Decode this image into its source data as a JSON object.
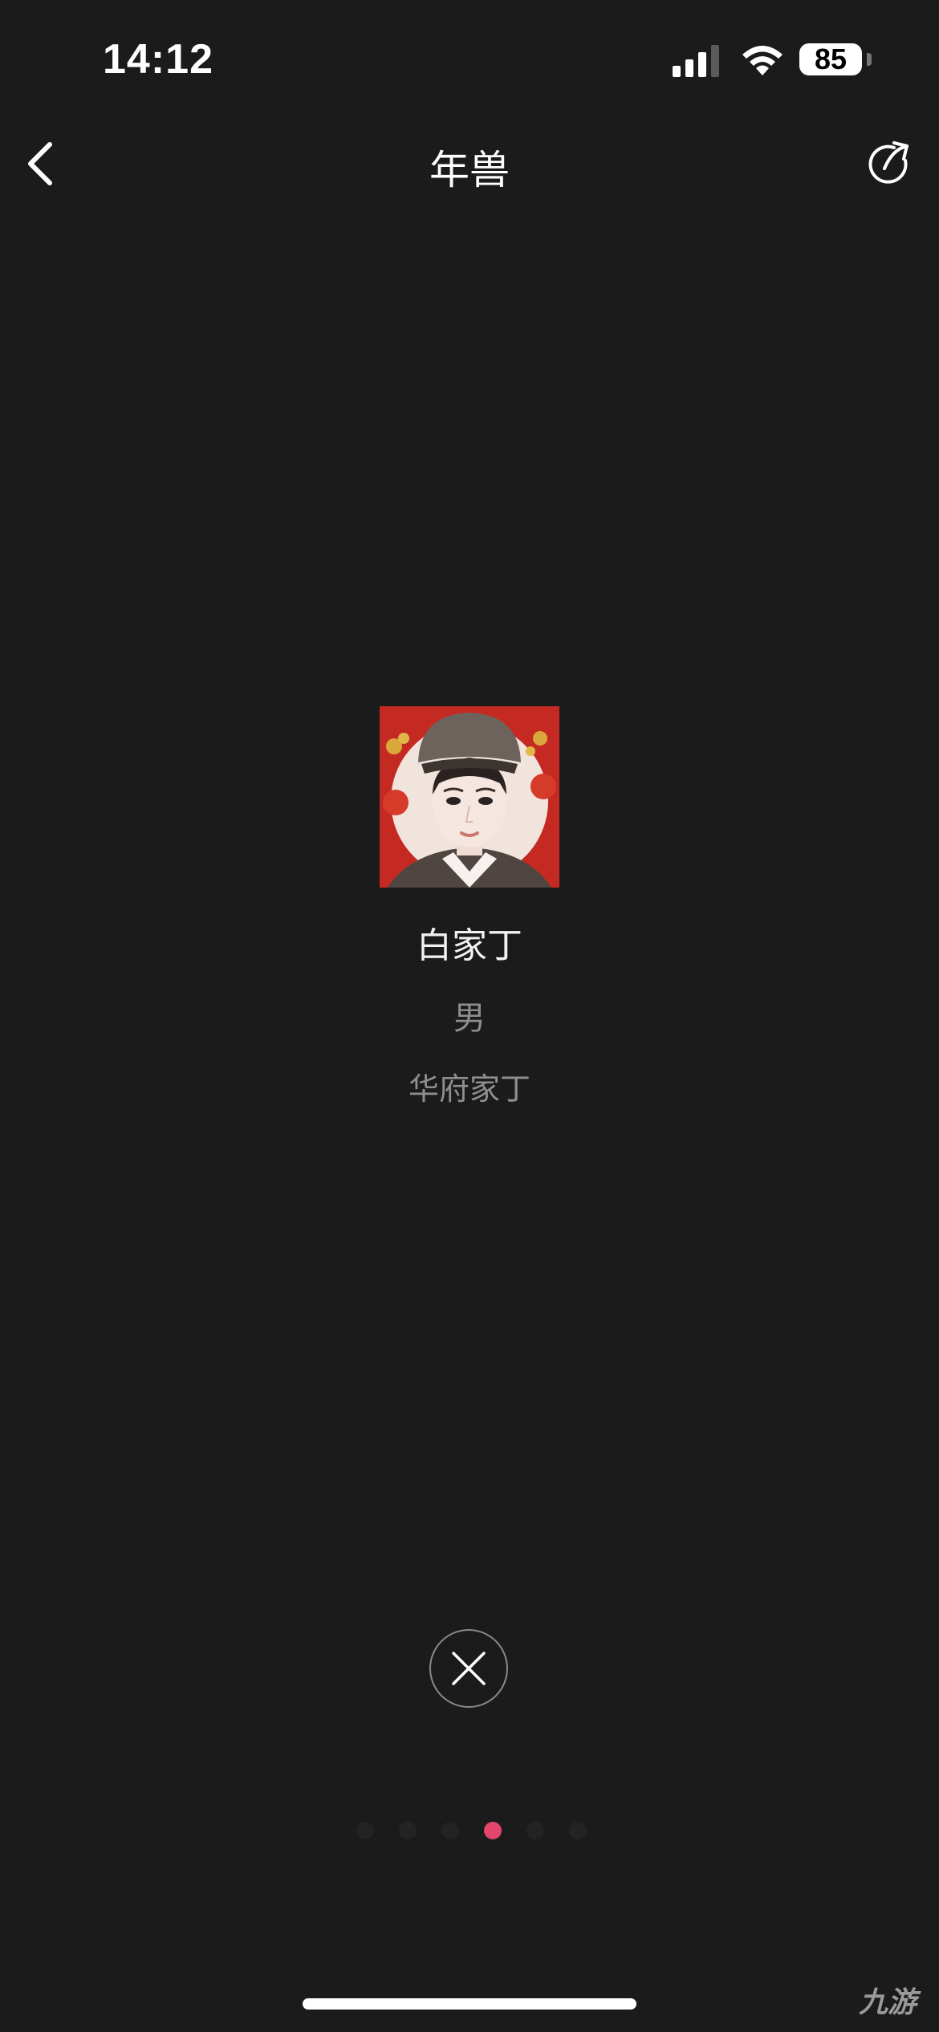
{
  "status_bar": {
    "time": "14:12",
    "battery_level": "85",
    "icons": [
      "signal-icon",
      "wifi-icon",
      "battery-icon"
    ]
  },
  "nav": {
    "title": "年兽",
    "back_icon": "chevron-left-icon",
    "share_icon": "share-icon"
  },
  "character": {
    "name": "白家丁",
    "gender": "男",
    "role": "华府家丁"
  },
  "actions": {
    "close_icon": "close-icon"
  },
  "pagination": {
    "total": 6,
    "current": 4
  },
  "colors": {
    "background": "#1b1b1b",
    "accent": "#e3456b",
    "secondary_text": "#8e8e8e"
  },
  "watermark": {
    "text": "九游"
  }
}
